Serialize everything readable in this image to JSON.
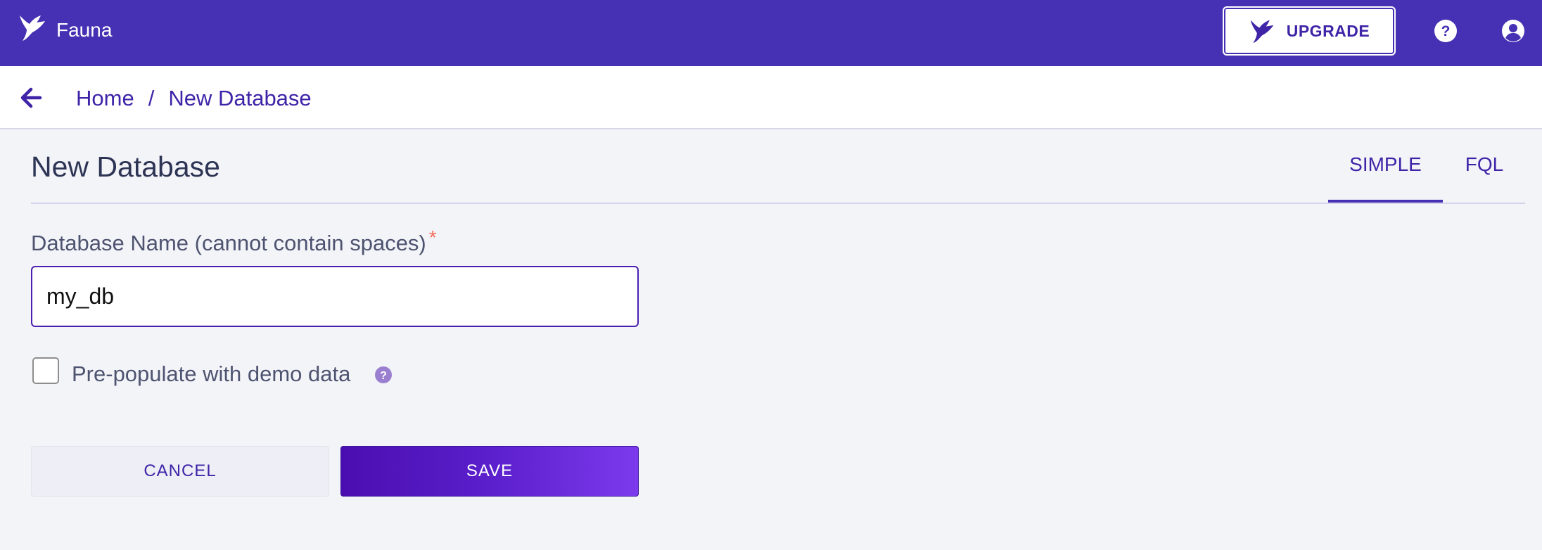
{
  "header": {
    "brand_name": "Fauna",
    "upgrade_label": "UPGRADE",
    "icons": [
      "fauna-bird-icon",
      "help-icon",
      "account-icon"
    ],
    "colors": {
      "bar": "#4630b3",
      "accent": "#3f24a8"
    }
  },
  "breadcrumb": {
    "items": [
      "Home",
      "New Database"
    ],
    "separator": "/"
  },
  "main": {
    "title": "New Database",
    "tabs": [
      {
        "label": "SIMPLE",
        "active": true
      },
      {
        "label": "FQL",
        "active": false
      }
    ],
    "name_field": {
      "label": "Database Name (cannot contain spaces)",
      "required_marker": "*",
      "value": "my_db"
    },
    "demo_checkbox": {
      "label": "Pre-populate with demo data",
      "checked": false
    },
    "buttons": {
      "cancel": "CANCEL",
      "save": "SAVE"
    }
  }
}
